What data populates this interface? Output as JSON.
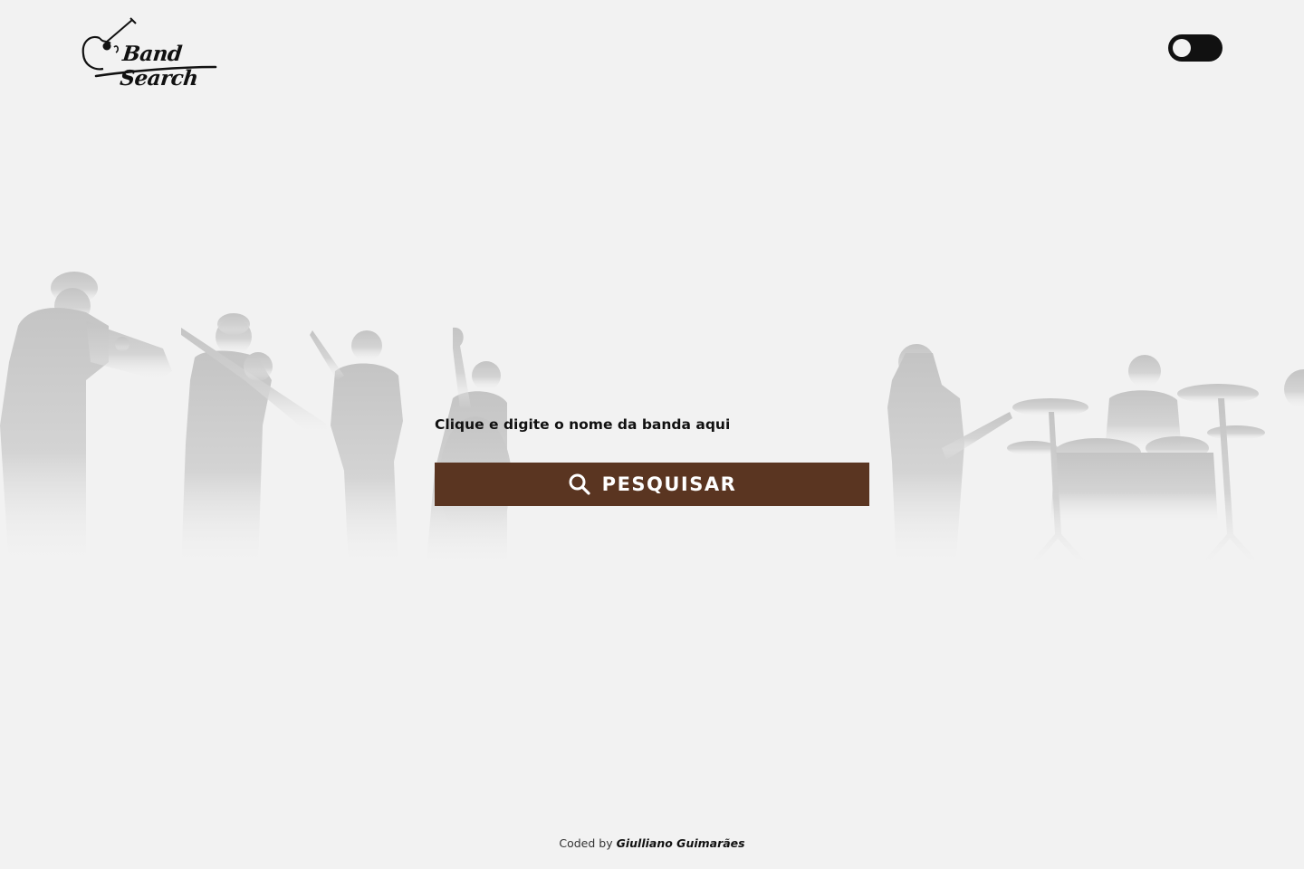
{
  "header": {
    "logo_text": "Band Search",
    "theme_toggle_state": "light"
  },
  "search": {
    "label": "Clique e digite o nome da banda aqui",
    "input_value": "",
    "button_label": "PESQUISAR",
    "button_icon": "search-icon"
  },
  "footer": {
    "prefix": "Coded by",
    "author": "Giulliano Guimarães"
  },
  "colors": {
    "background": "#f2f2f2",
    "button": "#5a3521",
    "button_text": "#ffffff",
    "toggle": "#111111",
    "silhouette": "#c8c8c8"
  },
  "icons": [
    "guitar-logo-icon",
    "search-icon",
    "musician-silhouettes"
  ]
}
